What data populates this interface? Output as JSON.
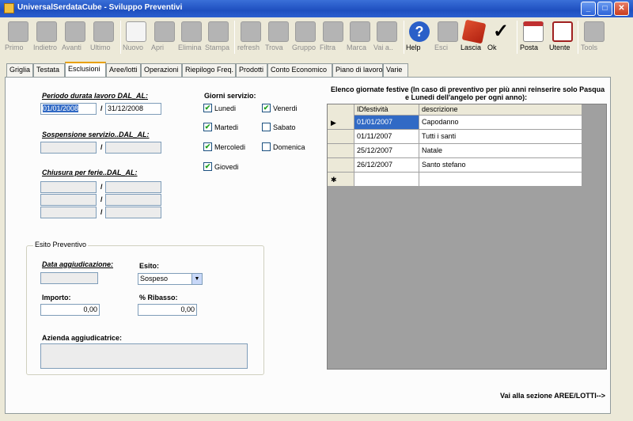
{
  "window": {
    "title": "UniversalSerdataCube - Sviluppo Preventivi",
    "minimize_glyph": "_",
    "maximize_glyph": "□",
    "close_glyph": "✕"
  },
  "toolbar": {
    "buttons": [
      {
        "label": "Primo",
        "icon": "first-arrow-icon",
        "enabled": false
      },
      {
        "label": "Indietro",
        "icon": "back-arrow-icon",
        "enabled": false
      },
      {
        "label": "Avanti",
        "icon": "forward-arrow-icon",
        "enabled": false
      },
      {
        "label": "Ultimo",
        "icon": "last-arrow-icon",
        "enabled": false
      },
      {
        "label": "Nuovo",
        "icon": "new-document-icon",
        "enabled": false
      },
      {
        "label": "Apri",
        "icon": "open-folder-icon",
        "enabled": false
      },
      {
        "label": "Elimina",
        "icon": "trash-icon",
        "enabled": false
      },
      {
        "label": "Stampa",
        "icon": "print-icon",
        "enabled": false
      },
      {
        "label": "refresh",
        "icon": "refresh-icon",
        "enabled": false
      },
      {
        "label": "Trova",
        "icon": "binoculars-icon",
        "enabled": false
      },
      {
        "label": "Gruppo",
        "icon": "group-icon",
        "enabled": false
      },
      {
        "label": "Filtra",
        "icon": "filter-icon",
        "enabled": false
      },
      {
        "label": "Marca",
        "icon": "mark-icon",
        "enabled": false
      },
      {
        "label": "Vai a..",
        "icon": "goto-icon",
        "enabled": false
      },
      {
        "label": "Help",
        "icon": "help-icon",
        "enabled": true
      },
      {
        "label": "Esci",
        "icon": "exit-icon",
        "enabled": false
      },
      {
        "label": "Lascia",
        "icon": "leave-icon",
        "enabled": true
      },
      {
        "label": "Ok",
        "icon": "check-icon",
        "enabled": true
      },
      {
        "label": "Posta",
        "icon": "mail-icon",
        "enabled": true
      },
      {
        "label": "Utente",
        "icon": "user-icon",
        "enabled": true
      },
      {
        "label": "Tools",
        "icon": "tools-icon",
        "enabled": false
      }
    ],
    "check_glyph": "✓",
    "help_glyph": "?"
  },
  "tabs": [
    {
      "label": "Griglia",
      "active": false
    },
    {
      "label": "Testata",
      "active": false
    },
    {
      "label": "Esclusioni",
      "active": true
    },
    {
      "label": "Aree/lotti",
      "active": false
    },
    {
      "label": "Operazioni",
      "active": false
    },
    {
      "label": "Riepilogo Freq.",
      "active": false
    },
    {
      "label": "Prodotti",
      "active": false
    },
    {
      "label": "Conto Economico",
      "active": false
    },
    {
      "label": "Piano di lavoro",
      "active": false
    },
    {
      "label": "Varie",
      "active": false
    }
  ],
  "periodo": {
    "label": "Periodo durata lavoro DAL_AL:",
    "dal": "01/01/2008",
    "al": "31/12/2008"
  },
  "sospensione": {
    "label": "Sospensione servizio..DAL_AL:",
    "dal": "",
    "al": ""
  },
  "chiusura": {
    "label": "Chiusura per ferie..DAL_AL:",
    "rows": [
      {
        "dal": "",
        "al": ""
      },
      {
        "dal": "",
        "al": ""
      },
      {
        "dal": "",
        "al": ""
      }
    ]
  },
  "separator": "/",
  "giorni": {
    "label": "Giorni servizio:",
    "check_glyph": "✔",
    "days": [
      {
        "label": "Lunedi",
        "checked": true
      },
      {
        "label": "Martedi",
        "checked": true
      },
      {
        "label": "Mercoledi",
        "checked": true
      },
      {
        "label": "Giovedi",
        "checked": true
      },
      {
        "label": "Venerdi",
        "checked": true
      },
      {
        "label": "Sabato",
        "checked": false
      },
      {
        "label": "Domenica",
        "checked": false
      }
    ]
  },
  "esito_box": {
    "legend": "Esito Preventivo",
    "data_aggiudicazione_label": "Data aggiudicazione:",
    "data_aggiudicazione": "",
    "esito_label": "Esito:",
    "esito_value": "Sospeso",
    "importo_label": "Importo:",
    "importo_value": "0,00",
    "ribasso_label": "% Ribasso:",
    "ribasso_value": "0,00",
    "azienda_label": "Azienda aggiudicatrice:",
    "azienda_value": ""
  },
  "festive": {
    "title_line1": "Elenco giornate festive (In caso di preventivo per più anni reinserire solo Pasqua",
    "title_line2": "e Lunedi dell'angelo per ogni anno):",
    "columns": [
      "IDfestività",
      "descrizione"
    ],
    "current_row_marker": "▶",
    "new_row_marker": "✱",
    "rows": [
      {
        "id": "01/01/2007",
        "desc": "Capodanno"
      },
      {
        "id": "01/11/2007",
        "desc": "Tutti i santi"
      },
      {
        "id": "25/12/2007",
        "desc": "Natale"
      },
      {
        "id": "26/12/2007",
        "desc": "Santo stefano"
      }
    ]
  },
  "footer_link": "Vai alla sezione AREE/LOTTI-->"
}
